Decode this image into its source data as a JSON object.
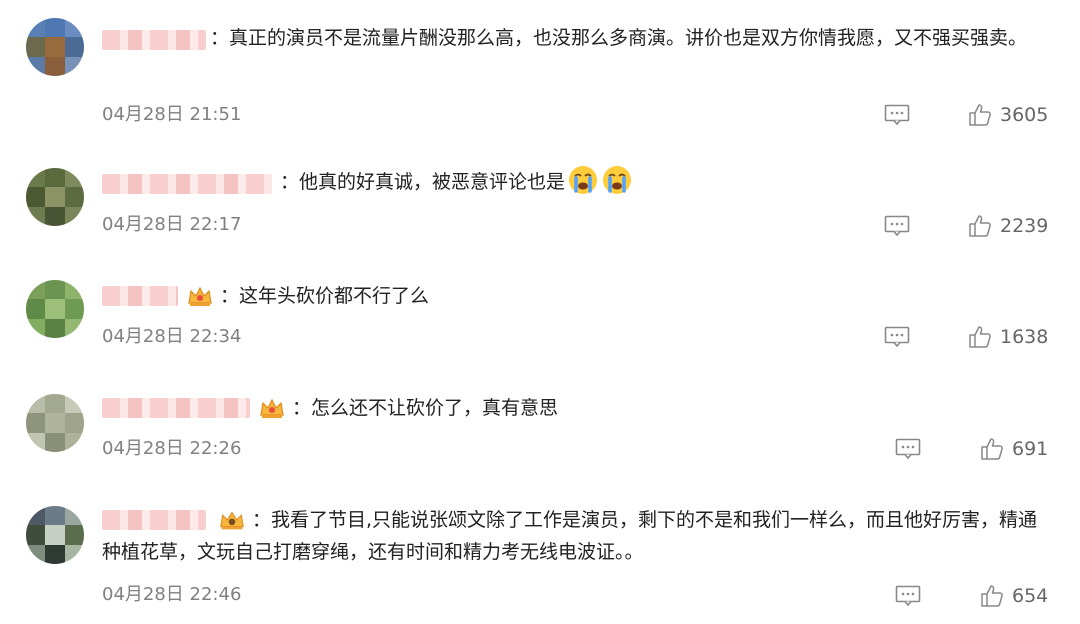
{
  "comments": [
    {
      "text": "：真正的演员不是流量片酬没那么高，也没那么多商演。讲价也是双方你情我愿，又不强买强卖。",
      "time": "04月28日 21:51",
      "likes": "3605",
      "avatar_colors": [
        "#5a7fb5",
        "#4f77b2",
        "#6a8cc0",
        "#6b6a4f",
        "#9a6a3f",
        "#4b6b94",
        "#5c7aa8",
        "#8a5e3a",
        "#7891b9"
      ]
    },
    {
      "text": "：他真的好真诚，被恶意评论也是",
      "emoji": [
        "crying-face-icon",
        "crying-face-icon"
      ],
      "time": "04月28日 22:17",
      "likes": "2239",
      "avatar_colors": [
        "#6b7a4a",
        "#5a6a3d",
        "#7f8a5c",
        "#4c5a34",
        "#8c9466",
        "#5d6b42",
        "#6f7c50",
        "#4a5535",
        "#7a8659"
      ]
    },
    {
      "text": "：这年头砍价都不行了么",
      "time": "04月28日 22:34",
      "likes": "1638",
      "avatar_colors": [
        "#7aa05a",
        "#6b9450",
        "#8db46a",
        "#5f8a48",
        "#9cc07a",
        "#6e9a53",
        "#83ad63",
        "#5a8244",
        "#94b872"
      ]
    },
    {
      "text": "：怎么还不让砍价了，真有意思",
      "time": "04月28日 22:26",
      "likes": "691",
      "avatar_colors": [
        "#b9bca8",
        "#a3a890",
        "#c8cab8",
        "#8f957c",
        "#b0b49c",
        "#9ea38a",
        "#c2c5b2",
        "#8a8f78",
        "#adb199"
      ]
    },
    {
      "text": "：我看了节目,只能说张颂文除了工作是演员，剩下的不是和我们一样么，而且他好厉害，精通种植花草，文玩自己打磨穿绳，还有时间和精力考无线电波证。。",
      "time": "04月28日 22:46",
      "likes": "654",
      "avatar_colors": [
        "#4d5a66",
        "#6b7b88",
        "#9aa6a0",
        "#3f4d3c",
        "#c8cfc4",
        "#5a6e4e",
        "#7f8c80",
        "#2f3a34",
        "#a9b5a3"
      ]
    }
  ],
  "colors": {
    "time": "#808080",
    "text": "#222222",
    "count": "#666666",
    "name_blur": "#f7c8c8"
  }
}
